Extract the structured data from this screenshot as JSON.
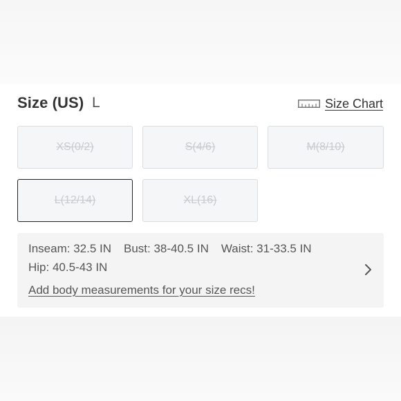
{
  "size_section": {
    "title": "Size (US)",
    "selected_size": "L",
    "size_chart_label": "Size Chart",
    "sizes": [
      {
        "label": "XS(0/2)",
        "available": false,
        "selected": false
      },
      {
        "label": "S(4/6)",
        "available": false,
        "selected": false
      },
      {
        "label": "M(8/10)",
        "available": false,
        "selected": false
      },
      {
        "label": "L(12/14)",
        "available": false,
        "selected": true
      },
      {
        "label": "XL(16)",
        "available": false,
        "selected": false
      }
    ]
  },
  "measurements": {
    "inseam": "Inseam: 32.5 IN",
    "bust": "Bust: 38-40.5 IN",
    "waist": "Waist: 31-33.5 IN",
    "hip": "Hip: 40.5-43 IN",
    "link_label": "Add body measurements for your size recs!"
  },
  "icons": {
    "size_chart": "ruler-icon",
    "details": "chevron-right-icon"
  },
  "colors": {
    "selected_border": "#222222",
    "unavailable_text": "#c7cbd0",
    "button_bg": "#f4f6f8"
  }
}
